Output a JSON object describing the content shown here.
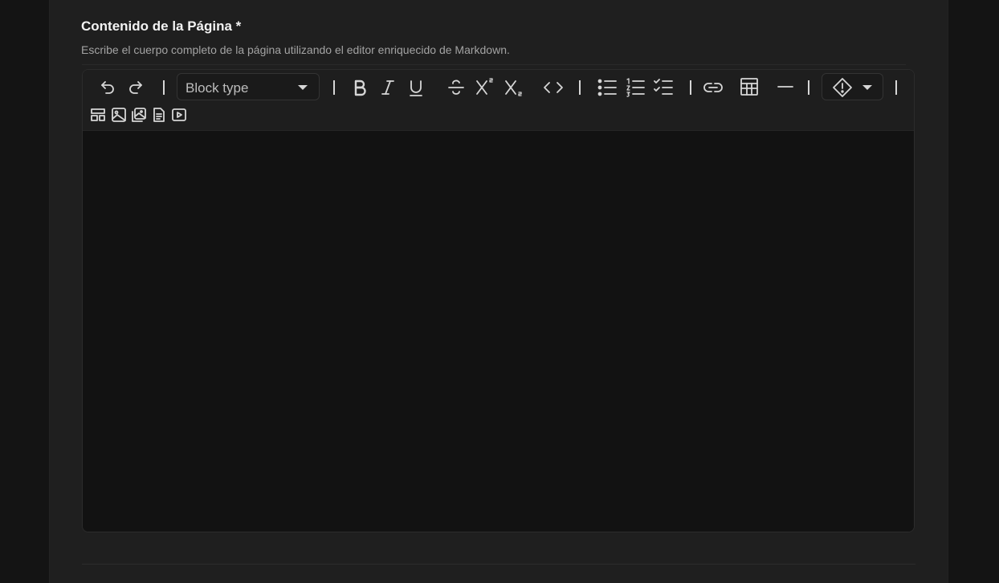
{
  "field": {
    "label": "Contenido de la Página *",
    "help": "Escribe el cuerpo completo de la página utilizando el editor enriquecido de Markdown."
  },
  "toolbar": {
    "block_type_placeholder": "Block type",
    "buttons": [
      "undo-icon",
      "redo-icon",
      "bold-icon",
      "italic-icon",
      "underline-icon",
      "strikethrough-icon",
      "superscript-icon",
      "subscript-icon",
      "code-icon",
      "bullet-list-icon",
      "numbered-list-icon",
      "checklist-icon",
      "link-icon",
      "table-icon",
      "horizontal-rule-icon",
      "admonition-icon",
      "layout-icon",
      "image-icon",
      "gallery-icon",
      "document-icon",
      "video-icon"
    ]
  },
  "colors": {
    "page_bg": "#141414",
    "panel_bg": "#1f1f1f",
    "editor_bg": "#121212",
    "toolbar_bg": "#1e1e1e",
    "icon": "#d6d6d6"
  }
}
